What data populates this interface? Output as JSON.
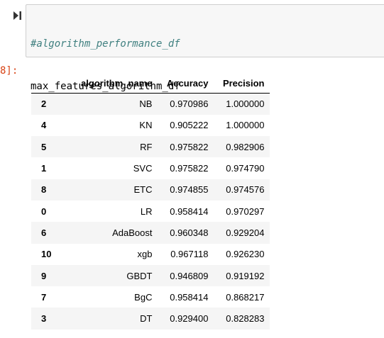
{
  "cell": {
    "comment_line": "#algorithm_performance_df",
    "code_line": "max_features_algorithm_df",
    "run_icon": "run-cell-icon"
  },
  "output": {
    "prompt": "8]:"
  },
  "table": {
    "columns": [
      "algorithm_name",
      "Accuracy",
      "Precision"
    ],
    "rows": [
      {
        "index": "2",
        "algorithm_name": "NB",
        "accuracy": "0.970986",
        "precision": "1.000000"
      },
      {
        "index": "4",
        "algorithm_name": "KN",
        "accuracy": "0.905222",
        "precision": "1.000000"
      },
      {
        "index": "5",
        "algorithm_name": "RF",
        "accuracy": "0.975822",
        "precision": "0.982906"
      },
      {
        "index": "1",
        "algorithm_name": "SVC",
        "accuracy": "0.975822",
        "precision": "0.974790"
      },
      {
        "index": "8",
        "algorithm_name": "ETC",
        "accuracy": "0.974855",
        "precision": "0.974576"
      },
      {
        "index": "0",
        "algorithm_name": "LR",
        "accuracy": "0.958414",
        "precision": "0.970297"
      },
      {
        "index": "6",
        "algorithm_name": "AdaBoost",
        "accuracy": "0.960348",
        "precision": "0.929204"
      },
      {
        "index": "10",
        "algorithm_name": "xgb",
        "accuracy": "0.967118",
        "precision": "0.926230"
      },
      {
        "index": "9",
        "algorithm_name": "GBDT",
        "accuracy": "0.946809",
        "precision": "0.919192"
      },
      {
        "index": "7",
        "algorithm_name": "BgC",
        "accuracy": "0.958414",
        "precision": "0.868217"
      },
      {
        "index": "3",
        "algorithm_name": "DT",
        "accuracy": "0.929400",
        "precision": "0.828283"
      }
    ]
  },
  "colors": {
    "prompt": "#d84315",
    "comment": "#408080",
    "cell_background": "#f7f7f7",
    "cell_border": "#cfcfcf",
    "stripe": "#f5f5f5"
  }
}
